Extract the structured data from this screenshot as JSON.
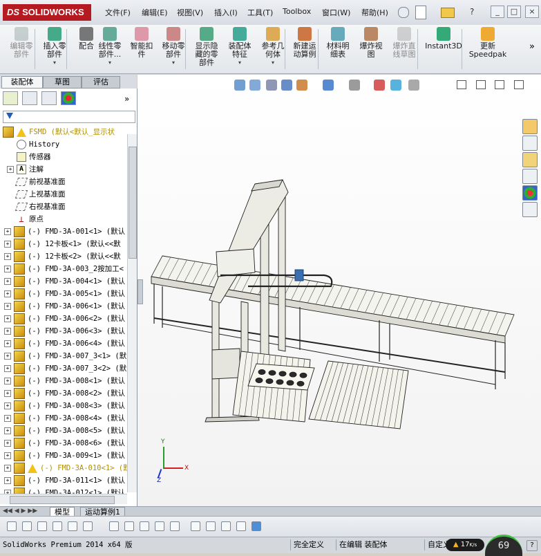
{
  "app": {
    "logo_brand": "SOLIDWORKS",
    "logo_prefix": "DS"
  },
  "menu": [
    "文件(F)",
    "编辑(E)",
    "视图(V)",
    "插入(I)",
    "工具(T)",
    "Toolbox",
    "窗口(W)",
    "帮助(H)"
  ],
  "window_controls": [
    "_",
    "□",
    "×"
  ],
  "toolbar": [
    {
      "label": "编辑零\n部件",
      "disabled": true
    },
    {
      "label": "插入零\n部件",
      "dd": true
    },
    {
      "label": "配合"
    },
    {
      "label": "线性零\n部件...",
      "dd": true
    },
    {
      "label": "智能扣\n件"
    },
    {
      "label": "移动零\n部件",
      "dd": true
    },
    {
      "label": "显示隐\n藏的零\n部件"
    },
    {
      "label": "装配体\n特征",
      "dd": true
    },
    {
      "label": "参考几\n何体",
      "dd": true
    },
    {
      "label": "新建运\n动算例"
    },
    {
      "label": "材料明\n细表"
    },
    {
      "label": "爆炸视\n图"
    },
    {
      "label": "爆炸直\n线草图",
      "disabled": true
    },
    {
      "label": "Instant3D"
    },
    {
      "label": "更新\nSpeedpak"
    }
  ],
  "toolbar_more": "»",
  "left_tabs": [
    "装配体",
    "草图",
    "评估"
  ],
  "panel_more": "»",
  "tree": [
    {
      "label": "FSMD  (默认<默认_显示状",
      "type": "root",
      "warn": true
    },
    {
      "label": "History",
      "type": "history",
      "indent": 1
    },
    {
      "label": "传感器",
      "type": "sensor",
      "indent": 1
    },
    {
      "label": "注解",
      "type": "annot",
      "indent": 1,
      "expand": true
    },
    {
      "label": "前视基准面",
      "type": "plane",
      "indent": 1
    },
    {
      "label": "上视基准面",
      "type": "plane",
      "indent": 1
    },
    {
      "label": "右视基准面",
      "type": "plane",
      "indent": 1
    },
    {
      "label": "原点",
      "type": "origin",
      "indent": 1
    },
    {
      "label": "(-) FMD-3A-001<1> (默认",
      "type": "part",
      "expand": true
    },
    {
      "label": "(-) 12卡板<1> (默认<<默",
      "type": "part",
      "expand": true
    },
    {
      "label": "(-) 12卡板<2> (默认<<默",
      "type": "part",
      "expand": true
    },
    {
      "label": "(-) FMD-3A-003_2按加工<",
      "type": "part",
      "expand": true
    },
    {
      "label": "(-) FMD-3A-004<1> (默认",
      "type": "part",
      "expand": true
    },
    {
      "label": "(-) FMD-3A-005<1> (默认",
      "type": "part",
      "expand": true
    },
    {
      "label": "(-) FMD-3A-006<1> (默认",
      "type": "part",
      "expand": true
    },
    {
      "label": "(-) FMD-3A-006<2> (默认",
      "type": "part",
      "expand": true
    },
    {
      "label": "(-) FMD-3A-006<3> (默认",
      "type": "part",
      "expand": true
    },
    {
      "label": "(-) FMD-3A-006<4> (默认",
      "type": "part",
      "expand": true
    },
    {
      "label": "(-) FMD-3A-007_3<1> (默",
      "type": "part",
      "expand": true
    },
    {
      "label": "(-) FMD-3A-007_3<2> (默",
      "type": "part",
      "expand": true
    },
    {
      "label": "(-) FMD-3A-008<1> (默认",
      "type": "part",
      "expand": true
    },
    {
      "label": "(-) FMD-3A-008<2> (默认",
      "type": "part",
      "expand": true
    },
    {
      "label": "(-) FMD-3A-008<3> (默认",
      "type": "part",
      "expand": true
    },
    {
      "label": "(-) FMD-3A-008<4> (默认",
      "type": "part",
      "expand": true
    },
    {
      "label": "(-) FMD-3A-008<5> (默认",
      "type": "part",
      "expand": true
    },
    {
      "label": "(-) FMD-3A-008<6> (默认",
      "type": "part",
      "expand": true
    },
    {
      "label": "(-) FMD-3A-009<1> (默认",
      "type": "part",
      "expand": true
    },
    {
      "label": "(-) FMD-3A-010<1> (默",
      "type": "part",
      "expand": true,
      "warn": true
    },
    {
      "label": "(-) FMD-3A-011<1> (默认",
      "type": "part",
      "expand": true
    },
    {
      "label": "(-) FMD-3A-012<1> (默认",
      "type": "part",
      "expand": true
    }
  ],
  "triad": {
    "x": "X",
    "y": "Y",
    "z": "Z"
  },
  "bottom_tabs": [
    "模型",
    "运动算例1"
  ],
  "status": {
    "product": "SolidWorks Premium 2014 x64 版",
    "constraint": "完全定义",
    "mode": "在编辑 装配体",
    "units": "自定义",
    "speed": "17",
    "speed_unit": "K/s",
    "percent": "69"
  },
  "colors": {
    "brand": "#b51a21",
    "warn_text": "#b09000",
    "accent_blue": "#1f5fb8"
  }
}
